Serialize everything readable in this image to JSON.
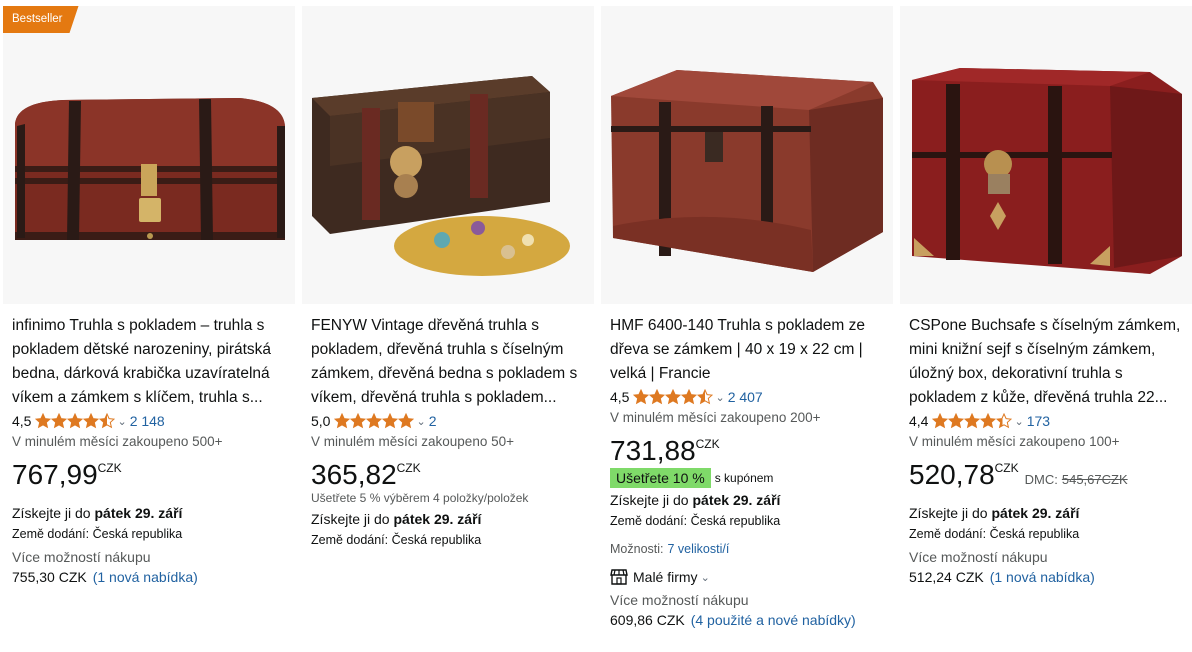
{
  "products": [
    {
      "badge": "Bestseller",
      "title": "infinimo Truhla s pokladem – truhla s pokladem dětské narozeniny, pirátská bedna, dárková krabička uzavíratelná víkem a zámkem s klíčem, truhla s...",
      "rating": "4,5",
      "stars": 4.5,
      "rating_count": "2 148",
      "bought": "V minulém měsíci zakoupeno 500+",
      "price_whole": "767,99",
      "price_currency": "CZK",
      "delivery_prefix": "Získejte ji do ",
      "delivery_date": "pátek 29. září",
      "country": "Země dodání: Česká republika",
      "more_label": "Více možností nákupu",
      "more_price": "755,30 CZK",
      "more_link": "(1 nová nabídka)"
    },
    {
      "title": "FENYW Vintage dřevěná truhla s pokladem, dřevěná truhla s číselným zámkem, dřevěná bedna s pokladem s víkem, dřevěná truhla s pokladem...",
      "rating": "5,0",
      "stars": 5,
      "rating_count": "2",
      "bought": "V minulém měsíci zakoupeno 50+",
      "price_whole": "365,82",
      "price_currency": "CZK",
      "save_text": "Ušetřete 5 % výběrem 4 položky/položek",
      "delivery_prefix": "Získejte ji do ",
      "delivery_date": "pátek 29. září",
      "country": "Země dodání: Česká republika"
    },
    {
      "title": "HMF 6400-140 Truhla s pokladem ze dřeva se zámkem | 40 x 19 x 22 cm | velká | Francie",
      "rating": "4,5",
      "stars": 4.5,
      "rating_count": "2 407",
      "bought": "V minulém měsíci zakoupeno 200+",
      "price_whole": "731,88",
      "price_currency": "CZK",
      "coupon_pill": "Ušetřete 10 %",
      "coupon_text": "s kupónem",
      "delivery_prefix": "Získejte ji do ",
      "delivery_date": "pátek 29. září",
      "country": "Země dodání: Česká republika",
      "options_label": "Možnosti:",
      "options_link": "7 velikosti/í",
      "small_business": "Malé firmy",
      "more_label": "Více možností nákupu",
      "more_price": "609,86 CZK",
      "more_link": "(4 použité a nové nabídky)"
    },
    {
      "title": "CSPone Buchsafe s číselným zámkem, mini knižní sejf s číselným zámkem, úložný box, dekorativní truhla s pokladem z kůže, dřevěná truhla 22...",
      "rating": "4,4",
      "stars": 4.4,
      "rating_count": "173",
      "bought": "V minulém měsíci zakoupeno 100+",
      "price_whole": "520,78",
      "price_currency": "CZK",
      "dmc_label": "DMC:",
      "dmc_price": "545,67CZK",
      "delivery_prefix": "Získejte ji do ",
      "delivery_date": "pátek 29. září",
      "country": "Země dodání: Česká republika",
      "more_label": "Více možností nákupu",
      "more_price": "512,24 CZK",
      "more_link": "(1 nová nabídka)"
    }
  ],
  "colors": {
    "star": "#de7921",
    "link": "#2162a1",
    "badge": "#e47911",
    "coupon": "#7fda69",
    "image_bg": "#f7f7f7"
  },
  "icons": {
    "rating_chevron": "chevron-down-icon",
    "small_business": "storefront-icon"
  }
}
